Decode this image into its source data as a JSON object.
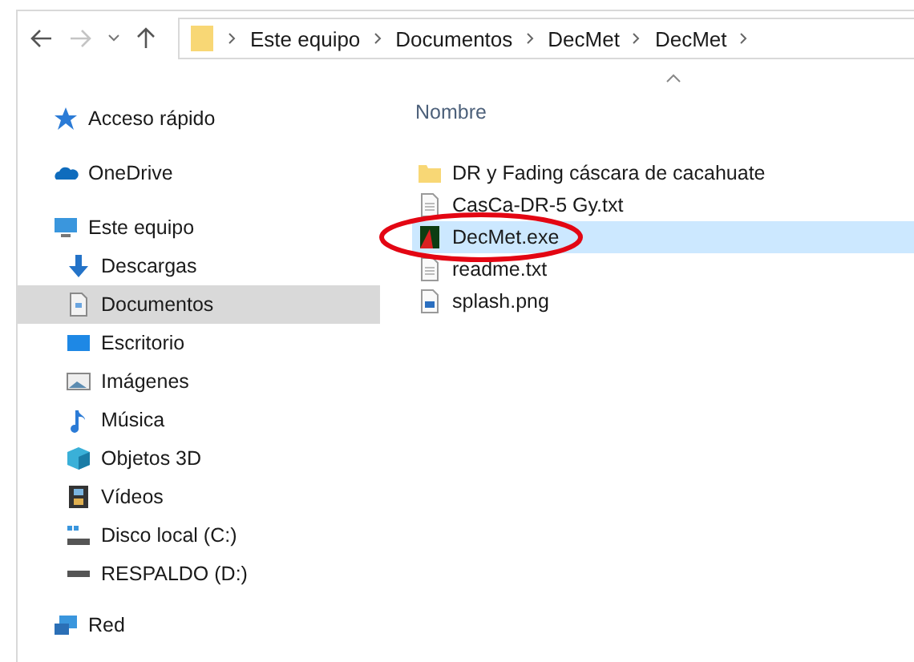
{
  "address_bar": {
    "path": [
      "Este equipo",
      "Documentos",
      "DecMet",
      "DecMet"
    ]
  },
  "sidebar": {
    "items": [
      {
        "label": "Acceso rápido",
        "kind": "star",
        "selected": false
      },
      {
        "label": "OneDrive",
        "kind": "cloud",
        "selected": false
      },
      {
        "label": "Este equipo",
        "kind": "pc",
        "selected": false,
        "children": [
          {
            "label": "Descargas",
            "kind": "download",
            "selected": false
          },
          {
            "label": "Documentos",
            "kind": "doc",
            "selected": true
          },
          {
            "label": "Escritorio",
            "kind": "desktop",
            "selected": false
          },
          {
            "label": "Imágenes",
            "kind": "image",
            "selected": false
          },
          {
            "label": "Música",
            "kind": "music",
            "selected": false
          },
          {
            "label": "Objetos 3D",
            "kind": "cube",
            "selected": false
          },
          {
            "label": "Vídeos",
            "kind": "video",
            "selected": false
          },
          {
            "label": "Disco local (C:)",
            "kind": "disk",
            "selected": false
          },
          {
            "label": "RESPALDO (D:)",
            "kind": "drive",
            "selected": false
          }
        ]
      },
      {
        "label": "Red",
        "kind": "network",
        "selected": false
      }
    ]
  },
  "file_list": {
    "column": "Nombre",
    "files": [
      {
        "name": "DR y Fading cáscara de cacahuate",
        "kind": "folder",
        "selected": false,
        "circled": false
      },
      {
        "name": "CasCa-DR-5 Gy.txt",
        "kind": "txt",
        "selected": false,
        "circled": false
      },
      {
        "name": "DecMet.exe",
        "kind": "exe",
        "selected": true,
        "circled": true
      },
      {
        "name": "readme.txt",
        "kind": "txt",
        "selected": false,
        "circled": false
      },
      {
        "name": "splash.png",
        "kind": "png",
        "selected": false,
        "circled": false
      }
    ]
  }
}
